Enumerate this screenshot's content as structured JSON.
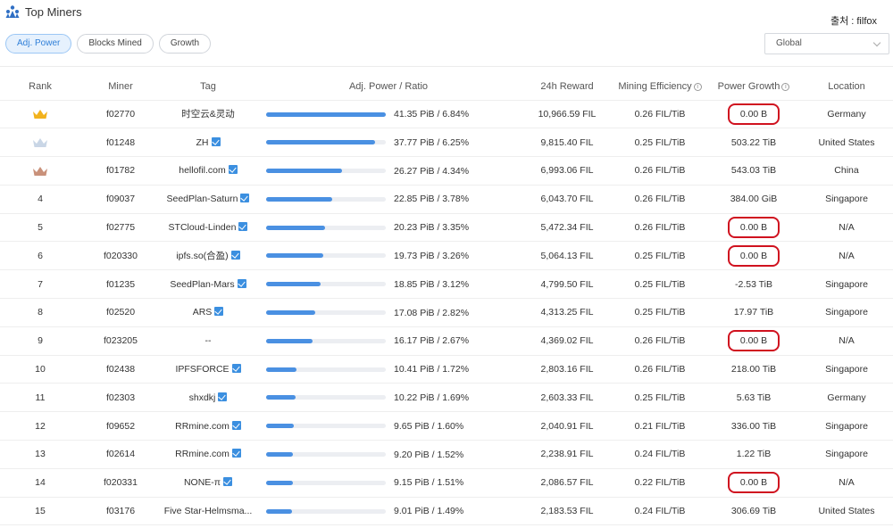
{
  "header": {
    "title": "Top Miners",
    "source": "출처 : filfox",
    "logo_icon": "miners-icon"
  },
  "tabs": [
    {
      "label": "Adj. Power",
      "active": true
    },
    {
      "label": "Blocks Mined",
      "active": false
    },
    {
      "label": "Growth",
      "active": false
    }
  ],
  "region_select": {
    "value": "Global"
  },
  "columns": [
    "Rank",
    "Miner",
    "Tag",
    "Adj. Power / Ratio",
    "24h Reward",
    "Mining Efficiency",
    "Power Growth",
    "Location"
  ],
  "rows": [
    {
      "rank": "",
      "crown": "gold",
      "miner": "f02770",
      "tag": "时空云&灵动",
      "verified": false,
      "share": 1.0,
      "power": "41.35 PiB / 6.84%",
      "reward": "10,966.59 FIL",
      "efficiency": "0.26 FIL/TiB",
      "growth": "0.00 B",
      "highlight": true,
      "location": "Germany"
    },
    {
      "rank": "",
      "crown": "silver",
      "miner": "f01248",
      "tag": "ZH",
      "verified": true,
      "share": 0.913,
      "power": "37.77 PiB / 6.25%",
      "reward": "9,815.40 FIL",
      "efficiency": "0.25 FIL/TiB",
      "growth": "503.22 TiB",
      "highlight": false,
      "location": "United States"
    },
    {
      "rank": "",
      "crown": "bronze",
      "miner": "f01782",
      "tag": "hellofil.com",
      "verified": true,
      "share": 0.635,
      "power": "26.27 PiB / 4.34%",
      "reward": "6,993.06 FIL",
      "efficiency": "0.26 FIL/TiB",
      "growth": "543.03 TiB",
      "highlight": false,
      "location": "China"
    },
    {
      "rank": "4",
      "crown": "",
      "miner": "f09037",
      "tag": "SeedPlan-Saturn",
      "verified": true,
      "share": 0.553,
      "power": "22.85 PiB / 3.78%",
      "reward": "6,043.70 FIL",
      "efficiency": "0.26 FIL/TiB",
      "growth": "384.00 GiB",
      "highlight": false,
      "location": "Singapore"
    },
    {
      "rank": "5",
      "crown": "",
      "miner": "f02775",
      "tag": "STCloud-Linden",
      "verified": true,
      "share": 0.489,
      "power": "20.23 PiB / 3.35%",
      "reward": "5,472.34 FIL",
      "efficiency": "0.26 FIL/TiB",
      "growth": "0.00 B",
      "highlight": true,
      "location": "N/A"
    },
    {
      "rank": "6",
      "crown": "",
      "miner": "f020330",
      "tag": "ipfs.so(合盈)",
      "verified": true,
      "share": 0.477,
      "power": "19.73 PiB / 3.26%",
      "reward": "5,064.13 FIL",
      "efficiency": "0.25 FIL/TiB",
      "growth": "0.00 B",
      "highlight": true,
      "location": "N/A"
    },
    {
      "rank": "7",
      "crown": "",
      "miner": "f01235",
      "tag": "SeedPlan-Mars",
      "verified": true,
      "share": 0.456,
      "power": "18.85 PiB / 3.12%",
      "reward": "4,799.50 FIL",
      "efficiency": "0.25 FIL/TiB",
      "growth": "-2.53 TiB",
      "highlight": false,
      "location": "Singapore"
    },
    {
      "rank": "8",
      "crown": "",
      "miner": "f02520",
      "tag": "ARS",
      "verified": true,
      "share": 0.413,
      "power": "17.08 PiB / 2.82%",
      "reward": "4,313.25 FIL",
      "efficiency": "0.25 FIL/TiB",
      "growth": "17.97 TiB",
      "highlight": false,
      "location": "Singapore"
    },
    {
      "rank": "9",
      "crown": "",
      "miner": "f023205",
      "tag": "--",
      "verified": false,
      "share": 0.391,
      "power": "16.17 PiB / 2.67%",
      "reward": "4,369.02 FIL",
      "efficiency": "0.26 FIL/TiB",
      "growth": "0.00 B",
      "highlight": true,
      "location": "N/A"
    },
    {
      "rank": "10",
      "crown": "",
      "miner": "f02438",
      "tag": "IPFSFORCE",
      "verified": true,
      "share": 0.252,
      "power": "10.41 PiB / 1.72%",
      "reward": "2,803.16 FIL",
      "efficiency": "0.26 FIL/TiB",
      "growth": "218.00 TiB",
      "highlight": false,
      "location": "Singapore"
    },
    {
      "rank": "11",
      "crown": "",
      "miner": "f02303",
      "tag": "shxdkj",
      "verified": true,
      "share": 0.247,
      "power": "10.22 PiB / 1.69%",
      "reward": "2,603.33 FIL",
      "efficiency": "0.25 FIL/TiB",
      "growth": "5.63 TiB",
      "highlight": false,
      "location": "Germany"
    },
    {
      "rank": "12",
      "crown": "",
      "miner": "f09652",
      "tag": "RRmine.com",
      "verified": true,
      "share": 0.233,
      "power": "9.65 PiB / 1.60%",
      "reward": "2,040.91 FIL",
      "efficiency": "0.21 FIL/TiB",
      "growth": "336.00 TiB",
      "highlight": false,
      "location": "Singapore"
    },
    {
      "rank": "13",
      "crown": "",
      "miner": "f02614",
      "tag": "RRmine.com",
      "verified": true,
      "share": 0.222,
      "power": "9.20 PiB / 1.52%",
      "reward": "2,238.91 FIL",
      "efficiency": "0.24 FIL/TiB",
      "growth": "1.22 TiB",
      "highlight": false,
      "location": "Singapore"
    },
    {
      "rank": "14",
      "crown": "",
      "miner": "f020331",
      "tag": "NONE-π",
      "verified": true,
      "share": 0.221,
      "power": "9.15 PiB / 1.51%",
      "reward": "2,086.57 FIL",
      "efficiency": "0.22 FIL/TiB",
      "growth": "0.00 B",
      "highlight": true,
      "location": "N/A"
    },
    {
      "rank": "15",
      "crown": "",
      "miner": "f03176",
      "tag": "Five Star-Helmsma...",
      "verified": false,
      "share": 0.218,
      "power": "9.01 PiB / 1.49%",
      "reward": "2,183.53 FIL",
      "efficiency": "0.24 FIL/TiB",
      "growth": "306.69 TiB",
      "highlight": false,
      "location": "United States"
    }
  ],
  "colors": {
    "accent": "#4a90e2",
    "highlight_ring": "#d0121f",
    "crown_gold": "#f2b21c",
    "crown_silver": "#c9d6e6",
    "crown_bronze": "#c9917a"
  }
}
